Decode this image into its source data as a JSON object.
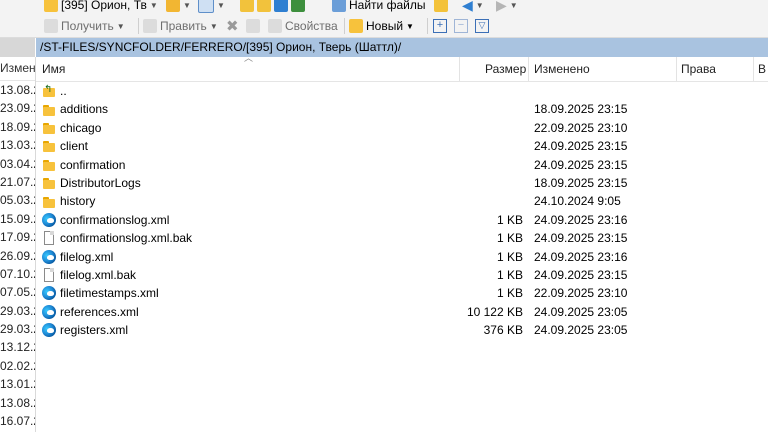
{
  "toolbar_top": {
    "drive_label": "[395] Орион, Тв",
    "find_files_label": "Найти файлы"
  },
  "toolbar": {
    "get_label": "Получить",
    "edit_label": "Править",
    "properties_label": "Свойства",
    "new_label": "Новый"
  },
  "path": "/ST-FILES/SYNCFOLDER/FERRERO/[395] Орион, Тверь (Шаттл)/",
  "left_pane": {
    "header": "Измен",
    "dates": [
      "13.08.2",
      "23.09.2",
      "18.09.2",
      "13.03.2",
      "03.04.2",
      "21.07.2",
      "05.03.2",
      "15.09.2",
      "17.09.2",
      "26.09.2",
      "07.10.2",
      "07.05.2",
      "29.03.2",
      "29.03.2",
      "13.12.2",
      "02.02.2",
      "13.01.2",
      "13.08.2",
      "16.07.2"
    ]
  },
  "columns": {
    "name": "Имя",
    "size": "Размер",
    "modified": "Изменено",
    "rights": "Права",
    "owner": "В"
  },
  "files": [
    {
      "icon": "parent-folder-icon",
      "name": "..",
      "size": "",
      "modified": ""
    },
    {
      "icon": "folder-icon",
      "name": "additions",
      "size": "",
      "modified": "18.09.2025 23:15"
    },
    {
      "icon": "folder-icon",
      "name": "chicago",
      "size": "",
      "modified": "22.09.2025 23:10"
    },
    {
      "icon": "folder-icon",
      "name": "client",
      "size": "",
      "modified": "24.09.2025 23:15"
    },
    {
      "icon": "folder-icon",
      "name": "confirmation",
      "size": "",
      "modified": "24.09.2025 23:15"
    },
    {
      "icon": "folder-icon",
      "name": "DistributorLogs",
      "size": "",
      "modified": "18.09.2025 23:15"
    },
    {
      "icon": "folder-icon",
      "name": "history",
      "size": "",
      "modified": "24.10.2024 9:05"
    },
    {
      "icon": "edge-xml-icon",
      "name": "confirmationslog.xml",
      "size": "1 KB",
      "modified": "24.09.2025 23:16"
    },
    {
      "icon": "file-icon",
      "name": "confirmationslog.xml.bak",
      "size": "1 KB",
      "modified": "24.09.2025 23:15"
    },
    {
      "icon": "edge-xml-icon",
      "name": "filelog.xml",
      "size": "1 KB",
      "modified": "24.09.2025 23:16"
    },
    {
      "icon": "file-icon",
      "name": "filelog.xml.bak",
      "size": "1 KB",
      "modified": "24.09.2025 23:15"
    },
    {
      "icon": "edge-xml-icon",
      "name": "filetimestamps.xml",
      "size": "1 KB",
      "modified": "22.09.2025 23:10"
    },
    {
      "icon": "edge-xml-icon",
      "name": "references.xml",
      "size": "10 122 KB",
      "modified": "24.09.2025 23:05"
    },
    {
      "icon": "edge-xml-icon",
      "name": "registers.xml",
      "size": "376 KB",
      "modified": "24.09.2025 23:05"
    }
  ]
}
